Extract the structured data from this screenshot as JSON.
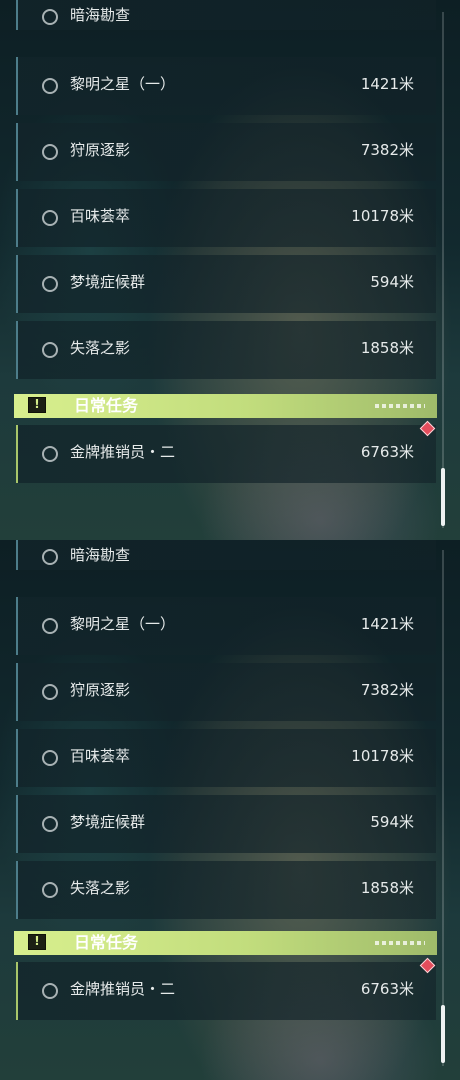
{
  "task_list": {
    "items": [
      {
        "name": "暗海勘查",
        "distance": ""
      },
      {
        "name": "黎明之星（一）",
        "distance": "1421米"
      },
      {
        "name": "狩原逐影",
        "distance": "7382米"
      },
      {
        "name": "百味荟萃",
        "distance": "10178米"
      },
      {
        "name": "梦境症候群",
        "distance": "594米"
      },
      {
        "name": "失落之影",
        "distance": "1858米"
      }
    ],
    "daily_section": {
      "title": "日常任务",
      "alert_glyph": "!",
      "items": [
        {
          "name": "金牌推销员・二",
          "distance": "6763米"
        }
      ]
    }
  },
  "icons": {
    "task_marker": "circle-ring-icon",
    "section_icon": "exclamation-box-icon",
    "new_badge": "red-diamond-icon"
  },
  "colors": {
    "accent_green": "#d8ef8e",
    "badge_red": "#e34d5c",
    "text": "#e6eaea"
  }
}
